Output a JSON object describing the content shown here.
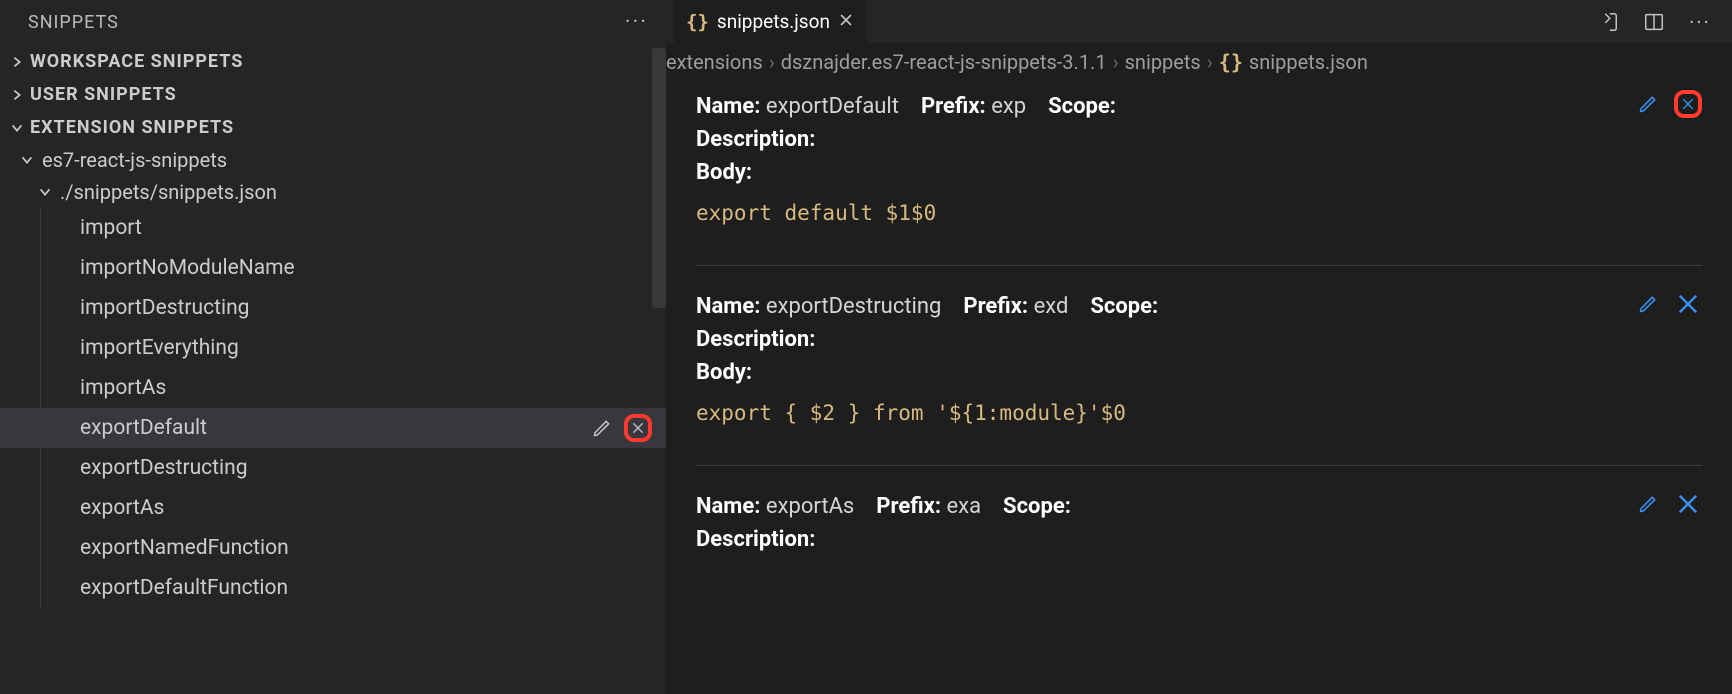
{
  "sidebar": {
    "title": "SNIPPETS",
    "sections": {
      "workspace": "WORKSPACE SNIPPETS",
      "user": "USER SNIPPETS",
      "extension": "EXTENSION SNIPPETS"
    },
    "ext_name": "es7-react-js-snippets",
    "ext_file": "./snippets/snippets.json",
    "items": [
      "import",
      "importNoModuleName",
      "importDestructing",
      "importEverything",
      "importAs",
      "exportDefault",
      "exportDestructing",
      "exportAs",
      "exportNamedFunction",
      "exportDefaultFunction"
    ],
    "selected_index": 5
  },
  "tab": {
    "filename": "snippets.json"
  },
  "breadcrumbs": {
    "parts": [
      "extensions",
      "dsznajder.es7-react-js-snippets-3.1.1",
      "snippets"
    ],
    "file": "snippets.json"
  },
  "labels": {
    "name": "Name:",
    "prefix": "Prefix:",
    "scope": "Scope:",
    "description": "Description:",
    "body": "Body:"
  },
  "blocks": [
    {
      "name": "exportDefault",
      "prefix": "exp",
      "scope": "",
      "description": "",
      "body": "export default $1$0",
      "highlight_x": true
    },
    {
      "name": "exportDestructing",
      "prefix": "exd",
      "scope": "",
      "description": "",
      "body": "export { $2 } from '${1:module}'$0",
      "highlight_x": false
    },
    {
      "name": "exportAs",
      "prefix": "exa",
      "scope": "",
      "description": "",
      "body": "",
      "highlight_x": false
    }
  ]
}
